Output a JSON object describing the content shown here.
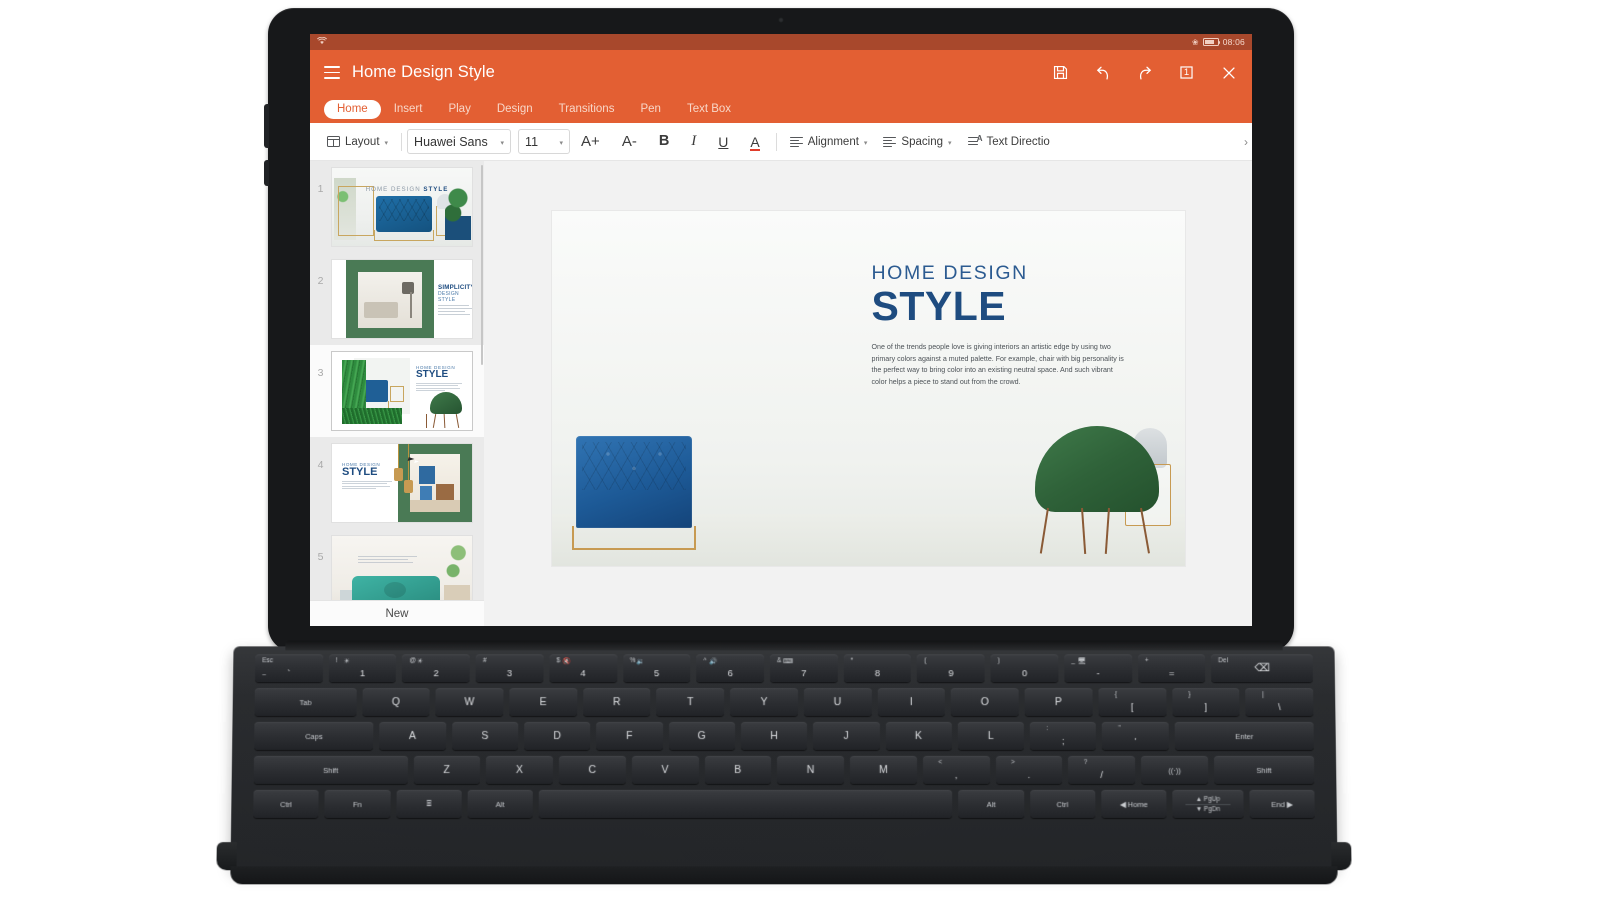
{
  "status_bar": {
    "wifi_icon": "wifi-icon",
    "bluetooth_icon": "bluetooth-icon",
    "battery_icon": "battery-icon",
    "time": "08:06"
  },
  "app_bar": {
    "menu_icon": "hamburger-menu-icon",
    "document_title": "Home Design Style",
    "actions": [
      {
        "name": "save-icon",
        "label": "Save"
      },
      {
        "name": "undo-icon",
        "label": "Undo"
      },
      {
        "name": "redo-icon",
        "label": "Redo"
      },
      {
        "name": "page-count-icon",
        "label": "1"
      },
      {
        "name": "close-icon",
        "label": "Close"
      }
    ],
    "page_badge": "1",
    "accent_color": "#e35f33",
    "status_bar_color": "#a8482c"
  },
  "ribbon": {
    "tabs": [
      {
        "label": "Home",
        "active": true
      },
      {
        "label": "Insert",
        "active": false
      },
      {
        "label": "Play",
        "active": false
      },
      {
        "label": "Design",
        "active": false
      },
      {
        "label": "Transitions",
        "active": false
      },
      {
        "label": "Pen",
        "active": false
      },
      {
        "label": "Text Box",
        "active": false
      }
    ]
  },
  "toolbar": {
    "layout_label": "Layout",
    "font_family_value": "Huawei Sans",
    "font_size_value": "11",
    "grow_font_label": "A+",
    "shrink_font_label": "A-",
    "bold_label": "B",
    "italic_label": "I",
    "underline_label": "U",
    "font_color_label": "A",
    "alignment_label": "Alignment",
    "spacing_label": "Spacing",
    "text_direction_label": "Text Directio",
    "overflow_caret": "›",
    "dropdown_caret": "▾",
    "font_color_swatch": "#e03d2b"
  },
  "slide_panel": {
    "new_slide_label": "New",
    "selected_index": 3,
    "slides": [
      {
        "number": "1",
        "title_kicker": "HOME DESIGN ",
        "title_bold": "STYLE"
      },
      {
        "number": "2",
        "title_line1": "SIMPLICITY",
        "title_line2": "DESIGN STYLE"
      },
      {
        "number": "3",
        "title_kicker": "HOME DESIGN",
        "title_bold": "STYLE"
      },
      {
        "number": "4",
        "title_kicker": "HOME DESIGN",
        "title_bold": "STYLE"
      },
      {
        "number": "5",
        "title_kicker": "",
        "title_bold": ""
      }
    ]
  },
  "slide_canvas": {
    "kicker": "HOME DESIGN",
    "title": "STYLE",
    "body": "One of the trends people love is giving interiors an artistic edge by using two primary colors against a muted palette. For example, chair with big personality is the perfect way to bring color into an existing neutral space. And such vibrant color helps a piece to stand out from the crowd.",
    "kicker_color": "#2c5b91",
    "title_color": "#1e4c80"
  },
  "keyboard": {
    "rows": [
      [
        {
          "type": "key",
          "main": "",
          "tl": "Esc",
          "bl": "~",
          "bc": "`",
          "w": ""
        },
        {
          "type": "key",
          "tc": "☀",
          "bc": "1",
          "tl2": "!"
        },
        {
          "type": "key",
          "tc": "☀",
          "bc": "2",
          "tl2": "@"
        },
        {
          "type": "key",
          "tc": "",
          "bc": "3",
          "tl2": "#"
        },
        {
          "type": "key",
          "tc": "🔇",
          "bc": "4",
          "tl2": "$"
        },
        {
          "type": "key",
          "tc": "🔉",
          "bc": "5",
          "tl2": "%"
        },
        {
          "type": "key",
          "tc": "🔊",
          "bc": "6",
          "tl2": "^"
        },
        {
          "type": "key",
          "tc": "⌨",
          "bc": "7",
          "tl2": "&"
        },
        {
          "type": "key",
          "tc": "",
          "bc": "8",
          "tl2": "*"
        },
        {
          "type": "key",
          "tc": "",
          "bc": "9",
          "tl2": "("
        },
        {
          "type": "key",
          "tc": "",
          "bc": "0",
          "tl2": ")"
        },
        {
          "type": "key",
          "tc": "🖥",
          "bc": "-",
          "tl2": "_"
        },
        {
          "type": "key",
          "tc": "",
          "bc": "=",
          "tl2": "+"
        },
        {
          "type": "key",
          "main": "⌫",
          "tl": "Del",
          "w": "wide-bksp"
        }
      ],
      [
        {
          "type": "key",
          "main": "Tab",
          "sm": true,
          "w": "wide-tab"
        },
        {
          "type": "key",
          "main": "Q"
        },
        {
          "type": "key",
          "main": "W"
        },
        {
          "type": "key",
          "main": "E"
        },
        {
          "type": "key",
          "main": "R"
        },
        {
          "type": "key",
          "main": "T"
        },
        {
          "type": "key",
          "main": "Y"
        },
        {
          "type": "key",
          "main": "U"
        },
        {
          "type": "key",
          "main": "I"
        },
        {
          "type": "key",
          "main": "O"
        },
        {
          "type": "key",
          "main": "P"
        },
        {
          "type": "key",
          "bc": "[",
          "tc": "{"
        },
        {
          "type": "key",
          "bc": "]",
          "tc": "}"
        },
        {
          "type": "key",
          "bc": "\\",
          "tc": "|"
        }
      ],
      [
        {
          "type": "key",
          "main": "Caps",
          "sm": true,
          "w": "wide-caps"
        },
        {
          "type": "key",
          "main": "A"
        },
        {
          "type": "key",
          "main": "S"
        },
        {
          "type": "key",
          "main": "D"
        },
        {
          "type": "key",
          "main": "F"
        },
        {
          "type": "key",
          "main": "G"
        },
        {
          "type": "key",
          "main": "H"
        },
        {
          "type": "key",
          "main": "J"
        },
        {
          "type": "key",
          "main": "K"
        },
        {
          "type": "key",
          "main": "L"
        },
        {
          "type": "key",
          "bc": ";",
          "tc": ":"
        },
        {
          "type": "key",
          "bc": "'",
          "tc": "\""
        },
        {
          "type": "key",
          "main": "Enter",
          "sm": true,
          "w": "wide-enter"
        }
      ],
      [
        {
          "type": "key",
          "main": "Shift",
          "sm": true,
          "w": "wide-shiftL"
        },
        {
          "type": "key",
          "main": "Z"
        },
        {
          "type": "key",
          "main": "X"
        },
        {
          "type": "key",
          "main": "C"
        },
        {
          "type": "key",
          "main": "V"
        },
        {
          "type": "key",
          "main": "B"
        },
        {
          "type": "key",
          "main": "N"
        },
        {
          "type": "key",
          "main": "M"
        },
        {
          "type": "key",
          "bc": ",",
          "tc": "<"
        },
        {
          "type": "key",
          "bc": ".",
          "tc": ">"
        },
        {
          "type": "key",
          "bc": "/",
          "tc": "?"
        },
        {
          "type": "key",
          "main": "((·))",
          "sm": true
        },
        {
          "type": "key",
          "main": "Shift",
          "sm": true,
          "w": "wide-shiftR"
        }
      ],
      [
        {
          "type": "key",
          "main": "Ctrl",
          "sm": true,
          "w": "ctl"
        },
        {
          "type": "key",
          "main": "Fn",
          "sm": true,
          "w": "ctl"
        },
        {
          "type": "key",
          "main": "⌸",
          "sm": true,
          "w": "ctl"
        },
        {
          "type": "key",
          "main": "Alt",
          "sm": true,
          "w": "ctl"
        },
        {
          "type": "key",
          "main": "",
          "w": "space"
        },
        {
          "type": "key",
          "main": "Alt",
          "sm": true,
          "w": "ctl"
        },
        {
          "type": "key",
          "main": "Ctrl",
          "sm": true,
          "w": "ctl"
        },
        {
          "type": "key",
          "main": "◀ Home",
          "sm": true,
          "w": "ctl"
        },
        {
          "type": "arrows",
          "up": "▲ PgUp",
          "down": "▼ PgDn",
          "w": "arrowgrp"
        },
        {
          "type": "key",
          "main": "End ▶",
          "sm": true,
          "w": "ctl"
        }
      ]
    ]
  }
}
